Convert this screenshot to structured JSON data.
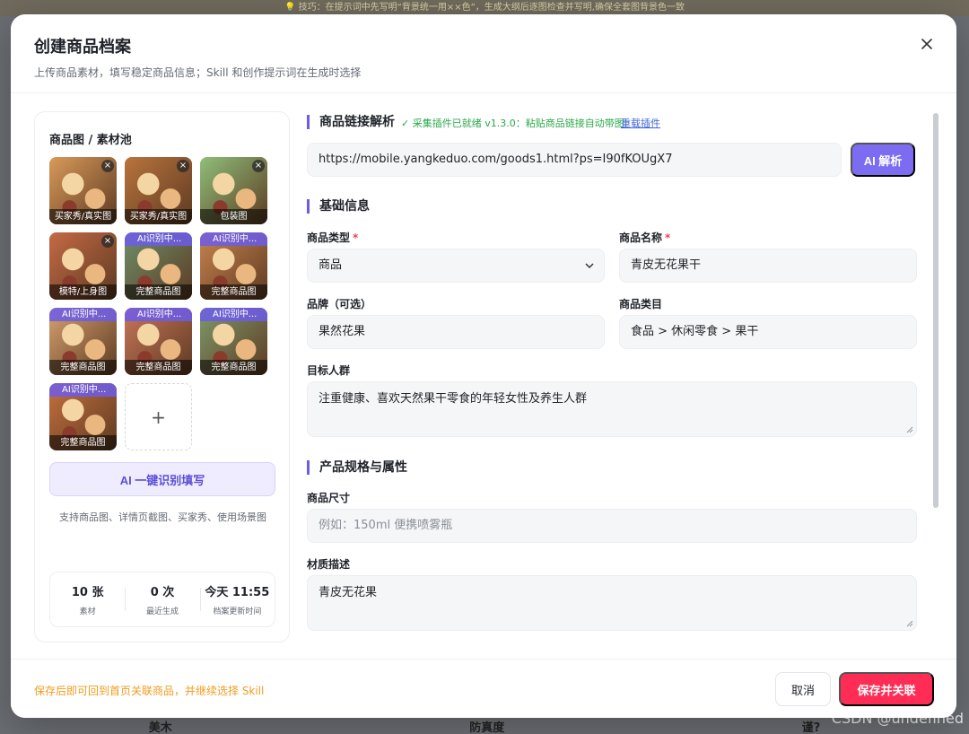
{
  "background": {
    "tip_text": "💡 技巧：在提示词中先写明“背景统一用××色”，生成大纲后逐图检查并写明,确保全套图背景色一致",
    "bottom_labels": [
      "美木",
      "防真度",
      "谨?"
    ],
    "watermark": "CSDN @undefined"
  },
  "modal": {
    "title": "创建商品档案",
    "subtitle": "上传商品素材，填写稳定商品信息；Skill 和创作提示词在生成时选择",
    "close_icon": "close-icon"
  },
  "asset_pool": {
    "title": "商品图 / 素材池",
    "thumbnails": [
      {
        "caption": "买家秀/真实图",
        "badge": "",
        "removable": true,
        "tone": "#d99a5a"
      },
      {
        "caption": "买家秀/真实图",
        "badge": "",
        "removable": true,
        "tone": "#b9743d"
      },
      {
        "caption": "包装图",
        "badge": "",
        "removable": true,
        "tone": "#8fbf7a"
      },
      {
        "caption": "模特/上身图",
        "badge": "",
        "removable": true,
        "tone": "#c46a45"
      },
      {
        "caption": "完整商品图",
        "badge": "AI识别中...",
        "removable": false,
        "tone": "#6e8f6a"
      },
      {
        "caption": "完整商品图",
        "badge": "AI识别中...",
        "removable": false,
        "tone": "#c8844f"
      },
      {
        "caption": "完整商品图",
        "badge": "AI识别中...",
        "removable": false,
        "tone": "#d6a271"
      },
      {
        "caption": "完整商品图",
        "badge": "AI识别中...",
        "removable": false,
        "tone": "#c9765a"
      },
      {
        "caption": "完整商品图",
        "badge": "AI识别中...",
        "removable": false,
        "tone": "#7f9a6b"
      },
      {
        "caption": "完整商品图",
        "badge": "AI识别中...",
        "removable": false,
        "tone": "#c6703f"
      }
    ],
    "add_label": "+",
    "ai_fill_button": "AI 一键识别填写",
    "support_note": "支持商品图、详情页截图、买家秀、使用场景图",
    "stats": [
      {
        "value": "10 张",
        "label": "素材"
      },
      {
        "value": "0 次",
        "label": "最近生成"
      },
      {
        "value": "今天 11:55",
        "label": "档案更新时间"
      }
    ]
  },
  "link_section": {
    "title": "商品链接解析",
    "plugin_status": "✓ 采集插件已就绪 v1.3.0：粘贴商品链接自动带图",
    "reload_link": "重载插件",
    "url_value": "https://mobile.yangkeduo.com/goods1.html?ps=I90fKOUgX7",
    "parse_button": "AI 解析"
  },
  "basic_section": {
    "title": "基础信息",
    "type_label": "商品类型",
    "type_required": "*",
    "type_value": "商品",
    "name_label": "商品名称",
    "name_required": "*",
    "name_value": "青皮无花果干",
    "brand_label": "品牌（可选）",
    "brand_value": "果然花果",
    "category_label": "商品类目",
    "category_value": "食品 > 休闲零食 > 果干",
    "audience_label": "目标人群",
    "audience_value": "注重健康、喜欢天然果干零食的年轻女性及养生人群"
  },
  "spec_section": {
    "title": "产品规格与属性",
    "size_label": "商品尺寸",
    "size_placeholder": "例如：150ml 便携喷雾瓶",
    "material_label": "材质描述",
    "material_value": "青皮无花果"
  },
  "footer": {
    "note": "保存后即可回到首页关联商品，并继续选择 Skill",
    "cancel": "取消",
    "save": "保存并关联"
  },
  "colors": {
    "accent": "#6c5ce7",
    "primary_button": "#ff2d55",
    "success": "#2ba84a",
    "warning": "#f29b1e"
  }
}
